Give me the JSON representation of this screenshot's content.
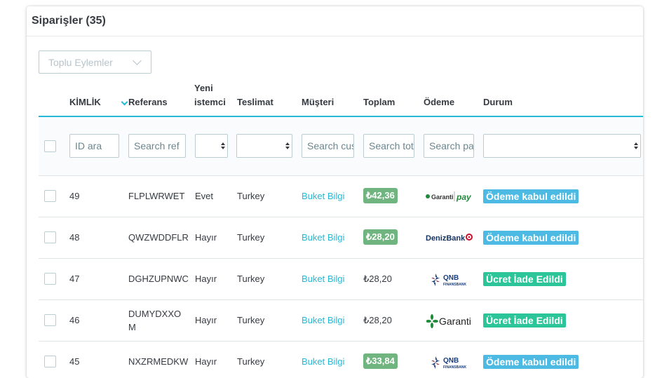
{
  "panel": {
    "title": "Siparişler (35)"
  },
  "bulk_actions": {
    "label": "Toplu Eylemler",
    "icon": "chevron-down-icon"
  },
  "columns": {
    "id": "KİMLİK",
    "reference": "Referans",
    "new_client_1": "Yeni",
    "new_client_2": "istemci",
    "delivery": "Teslimat",
    "customer": "Müşteri",
    "total": "Toplam",
    "payment": "Ödeme",
    "status": "Durum"
  },
  "filters": {
    "id_placeholder": "ID ara",
    "reference_placeholder": "Search ref",
    "customer_placeholder": "Search customer",
    "total_placeholder": "Search total",
    "payment_placeholder": "Search payment"
  },
  "colors": {
    "accent": "#25b9d7",
    "price_badge": "#70b580",
    "status_accepted": "#4cbae3",
    "status_refund": "#2cc599"
  },
  "rows": [
    {
      "id": "49",
      "reference": "FLPLWRWET",
      "new_client": "Evet",
      "delivery": "Turkey",
      "customer": "Buket Bilgi",
      "total": "₺42,36",
      "total_badge": true,
      "payment_logo": "garanti-pay-logo",
      "payment_text": "Garanti",
      "payment_sub": "pay",
      "status": "Ödeme kabul edildi",
      "status_kind": "blue"
    },
    {
      "id": "48",
      "reference": "QWZWDDFLR",
      "new_client": "Hayır",
      "delivery": "Turkey",
      "customer": "Buket Bilgi",
      "total": "₺28,20",
      "total_badge": true,
      "payment_logo": "denizbank-logo",
      "payment_text": "DenizBank",
      "status": "Ödeme kabul edildi",
      "status_kind": "blue"
    },
    {
      "id": "47",
      "reference": "DGHZUPNWC",
      "new_client": "Hayır",
      "delivery": "Turkey",
      "customer": "Buket Bilgi",
      "total": "₺28,20",
      "total_badge": false,
      "payment_logo": "qnb-finansbank-logo",
      "payment_text": "QNB",
      "payment_sub": "FINANSBANK",
      "status": "Ücret İade Edildi",
      "status_kind": "green"
    },
    {
      "id": "46",
      "reference_1": "DUMYDXXO",
      "reference_2": "M",
      "new_client": "Hayır",
      "delivery": "Turkey",
      "customer": "Buket Bilgi",
      "total": "₺28,20",
      "total_badge": false,
      "payment_logo": "garanti-logo",
      "payment_text": "Garanti",
      "status": "Ücret İade Edildi",
      "status_kind": "green"
    },
    {
      "id": "45",
      "reference": "NXZRMEDKW",
      "new_client": "Hayır",
      "delivery": "Turkey",
      "customer": "Buket Bilgi",
      "total": "₺33,84",
      "total_badge": true,
      "payment_logo": "qnb-finansbank-logo",
      "payment_text": "QNB",
      "payment_sub": "FINANSBANK",
      "status": "Ödeme kabul edildi",
      "status_kind": "blue"
    }
  ]
}
